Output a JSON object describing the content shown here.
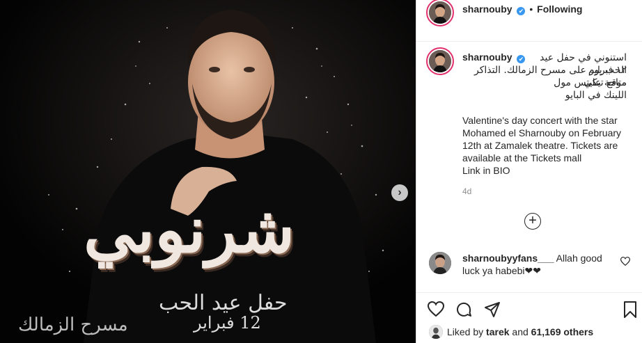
{
  "post": {
    "username": "sharnouby",
    "follow_status": "Following",
    "verified_mark": "✔",
    "next_arrow": "›",
    "image_text": {
      "main_title": "شرنوبي",
      "event": "حفل عيد الحب",
      "date": "12 فبراير",
      "venue": "مسرح الزمالك"
    },
    "caption": {
      "arabic_line1": "استنوني في حفل عيد الحب يوم",
      "arabic_line2": "١٢ فبراير  على مسرح الزمالك. التذاكر متاحة علي",
      "arabic_line3": "موقع تيكيتس مول",
      "arabic_line4": "اللينك في البايو",
      "english": "Valentine's day concert with the star Mohamed el Sharnouby on February 12th at Zamalek theatre.  Tickets are available at the Tickets mall",
      "english_last": "Link in BIO"
    },
    "time_ago": "4d",
    "load_more": "+",
    "comments": [
      {
        "username": "sharnoubyyfans___",
        "text": "Allah good luck ya habebi❤❤"
      }
    ],
    "likes": {
      "prefix": "Liked by",
      "user": "tarek",
      "conj": "and",
      "count": "61,169 others"
    }
  }
}
